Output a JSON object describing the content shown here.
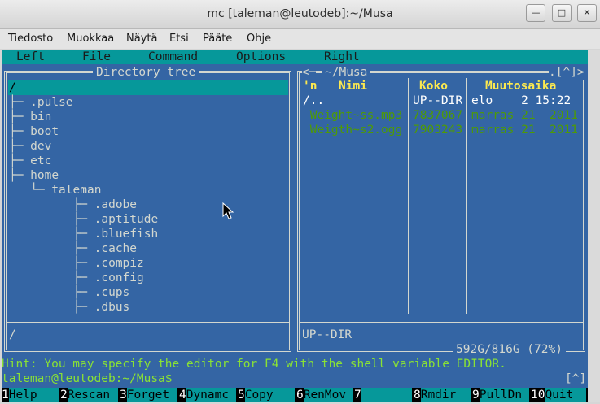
{
  "window": {
    "title": "mc [taleman@leutodeb]:~/Musa",
    "buttons": {
      "minimize": "—",
      "maximize": "□",
      "close": "✕"
    }
  },
  "app_menu": [
    "Tiedosto",
    "Muokkaa",
    "Näytä",
    "Etsi",
    "Pääte",
    "Ohje"
  ],
  "mc_menu": [
    "Left",
    "File",
    "Command",
    "Options",
    "Right"
  ],
  "left_panel": {
    "title": "Directory tree",
    "items": [
      {
        "prefix": "/",
        "name": ""
      },
      {
        "prefix": "├─ ",
        "name": ".pulse"
      },
      {
        "prefix": "├─ ",
        "name": "bin"
      },
      {
        "prefix": "├─ ",
        "name": "boot"
      },
      {
        "prefix": "├─ ",
        "name": "dev"
      },
      {
        "prefix": "├─ ",
        "name": "etc"
      },
      {
        "prefix": "├─ ",
        "name": "home"
      },
      {
        "prefix": "   └─ ",
        "name": "taleman"
      },
      {
        "prefix": "         ├─ ",
        "name": ".adobe"
      },
      {
        "prefix": "         ├─ ",
        "name": ".aptitude"
      },
      {
        "prefix": "         ├─ ",
        "name": ".bluefish"
      },
      {
        "prefix": "         ├─ ",
        "name": ".cache"
      },
      {
        "prefix": "         ├─ ",
        "name": ".compiz"
      },
      {
        "prefix": "         ├─ ",
        "name": ".config"
      },
      {
        "prefix": "         ├─ ",
        "name": ".cups"
      },
      {
        "prefix": "         ├─ ",
        "name": ".dbus"
      }
    ],
    "status": "/"
  },
  "right_panel": {
    "title": "~/Musa",
    "corner_left": "<─",
    "corner_right": ".[^]>",
    "columns": {
      "sort": "'n",
      "name": "Nimi",
      "size": "Koko",
      "mtime": "Muutosaika"
    },
    "rows": [
      {
        "name": "/..",
        "size": "UP--DIR",
        "mtime": "elo    2 15:22",
        "kind": "updir"
      },
      {
        "name": " Weight~ss.mp3",
        "size": "7837067",
        "mtime": "marras 21  2011",
        "kind": "music"
      },
      {
        "name": " Weigth~s2.ogg",
        "size": "7903243",
        "mtime": "marras 21  2011",
        "kind": "music"
      }
    ],
    "status": "UP--DIR",
    "disk": "592G/816G (72%)"
  },
  "hint": "Hint: You may specify the editor for F4 with the shell variable EDITOR.",
  "prompt": "taleman@leutodeb:~/Musa$",
  "prompt_right": "[^]",
  "keybar": [
    {
      "num": "1",
      "label": "Help"
    },
    {
      "num": "2",
      "label": "Rescan"
    },
    {
      "num": "3",
      "label": "Forget"
    },
    {
      "num": "4",
      "label": "Dynamc"
    },
    {
      "num": "5",
      "label": "Copy"
    },
    {
      "num": "6",
      "label": "RenMov"
    },
    {
      "num": "7",
      "label": ""
    },
    {
      "num": "8",
      "label": "Rmdir"
    },
    {
      "num": "9",
      "label": "PullDn"
    },
    {
      "num": "10",
      "label": "Quit"
    }
  ],
  "colors": {
    "terminal_bg": "#3465a4",
    "selection": "#06989a",
    "header": "#fce94f",
    "music_file": "#4e9a06",
    "hint": "#8ae234"
  }
}
